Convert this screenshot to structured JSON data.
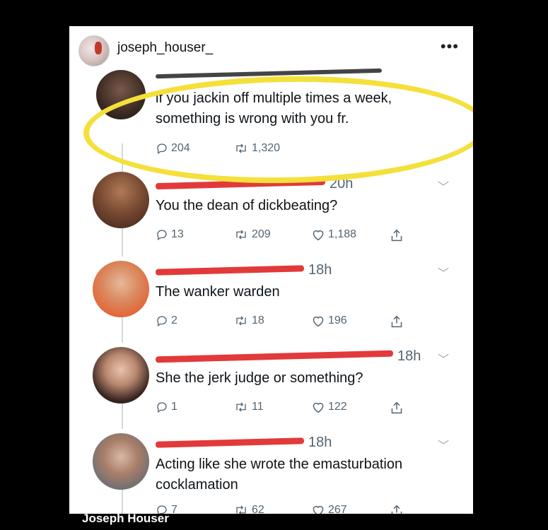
{
  "post": {
    "username": "joseph_houser_",
    "more_icon": "more-dots-icon",
    "footer_name": "Joseph Houser"
  },
  "tweets": [
    {
      "time": "",
      "text": "if you jackin off multiple times a week, something is wrong with you fr.",
      "replies": "204",
      "retweets": "1,320",
      "likes": "",
      "highlighted": true
    },
    {
      "time": "20h",
      "text": "You the dean of dickbeating?",
      "replies": "13",
      "retweets": "209",
      "likes": "1,188"
    },
    {
      "time": "18h",
      "text": "The wanker warden",
      "replies": "2",
      "retweets": "18",
      "likes": "196"
    },
    {
      "time": "18h",
      "text": "She the jerk judge or something?",
      "replies": "1",
      "retweets": "11",
      "likes": "122"
    },
    {
      "time": "18h",
      "text": "Acting like she wrote the emasturbation cocklamation",
      "replies": "7",
      "retweets": "62",
      "likes": "267"
    }
  ],
  "colors": {
    "highlight": "#f4e03a",
    "redaction": "#e23a3a",
    "meta_text": "#536471"
  }
}
